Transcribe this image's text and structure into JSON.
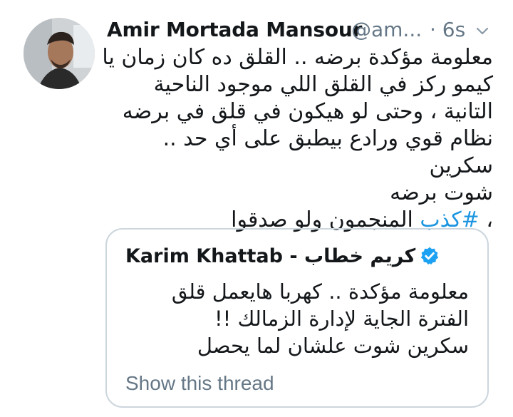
{
  "tweet": {
    "author": {
      "name": "Amir Mortada Mansour",
      "handle": "@am...",
      "avatar_icon": "profile-photo-icon"
    },
    "timestamp": "· 6s",
    "caret_icon": "chevron-down-icon",
    "text_lines": [
      "معلومة مؤكدة برضه .. القلق ده كان زمان يا",
      "كيمو ركز في القلق اللي موجود الناحية",
      "التانية ، وحتى لو هيكون في قلق في برضه",
      "نظام قوي ورادع بيطبق على أي حد .. سكرين",
      "شوت برضه"
    ],
    "hashtag": "#كذب",
    "last_line_rest": " المنجمون ولو صدقوا",
    "last_line_prefix": "، ",
    "colors": {
      "text": "#14171a",
      "secondary": "#657786",
      "link": "#1b95e0",
      "border": "#ccd6dd"
    }
  },
  "quote": {
    "name_en": "Karim Khattab - ",
    "name_ar": "كريم خطاب",
    "verified_icon": "verified-badge-icon",
    "text_lines": [
      "معلومة مؤكدة  .. كهربا هايعمل قلق",
      "الفترة الجاية لإدارة الزمالك  !!",
      "سكرين شوت علشان لما يحصل"
    ],
    "show_thread": "Show this thread"
  }
}
